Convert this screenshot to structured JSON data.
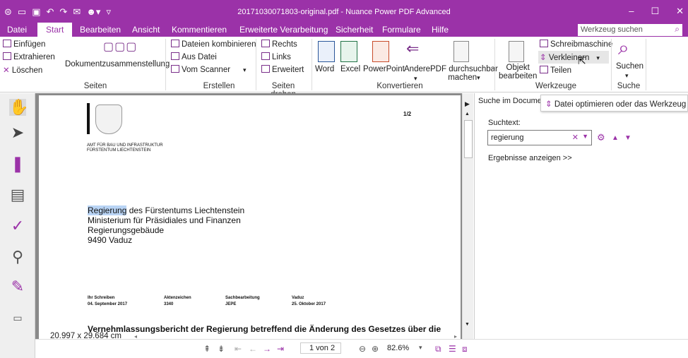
{
  "titlebar": {
    "title": "20171030071803-original.pdf - Nuance Power PDF Advanced",
    "minimize": "–",
    "maximize": "☐",
    "close": "✕"
  },
  "menubar": {
    "items": [
      "Datei",
      "Start",
      "Bearbeiten",
      "Ansicht",
      "Kommentieren",
      "Erweiterte Verarbeitung",
      "Sicherheit",
      "Formulare",
      "Hilfe"
    ],
    "search_placeholder": "Werkzeug suchen"
  },
  "ribbon": {
    "seiten": {
      "einfuegen": "Einfügen",
      "extrahieren": "Extrahieren",
      "loeschen": "Löschen",
      "dokument": "Dokumentzusammenstellung",
      "label": "Seiten"
    },
    "erstellen": {
      "kombinieren": "Dateien kombinieren",
      "ausdatei": "Aus Datei",
      "scanner": "Vom Scanner",
      "label": "Erstellen"
    },
    "drehen": {
      "rechts": "Rechts",
      "links": "Links",
      "erweitert": "Erweitert",
      "label": "Seiten drehen"
    },
    "konvertieren": {
      "word": "Word",
      "excel": "Excel",
      "powerpoint": "PowerPoint",
      "andere": "Andere",
      "pdf1": "PDF durchsuchbar",
      "pdf2": "machen",
      "label": "Konvertieren"
    },
    "werkzeuge": {
      "objekt1": "Objekt",
      "objekt2": "bearbeiten",
      "schreib": "Schreibmaschine",
      "verkl": "Verkleinern",
      "teilen": "Teilen",
      "label": "Werkzeuge"
    },
    "suche": {
      "suchen": "Suchen",
      "label": "Suche"
    }
  },
  "document": {
    "page_num": "1/2",
    "office1": "AMT FÜR BAU UND INFRASTRUKTUR",
    "office2": "FÜRSTENTUM LIECHTENSTEIN",
    "addr_hl": "Regierung",
    "addr1_rest": " des Fürstentums Liechtenstein",
    "addr2": "Ministerium für Präsidiales und Finanzen",
    "addr3": "Regierungsgebäude",
    "addr4": "9490 Vaduz",
    "h1": "Ihr Schreiben",
    "v1": "04. September 2017",
    "h2": "Aktenzeichen",
    "v2": "3340",
    "h3": "Sachbearbeitung",
    "v3": "JEPE",
    "h4": "Vaduz",
    "v4": "25. Oktober 2017",
    "subject": "Vernehmlassungsbericht der Regierung betreffend die Änderung des Gesetzes über die"
  },
  "status": {
    "dimensions": "20.997 x 29.684 cm",
    "page_field": "1 von 2",
    "zoom": "82.6%"
  },
  "search_panel": {
    "tab": "Suche im Documen",
    "tooltip": "Datei optimieren oder das Werkzeug „Dat",
    "label": "Suchtext:",
    "query": "regierung",
    "results_link": "Ergebnisse anzeigen >>"
  }
}
